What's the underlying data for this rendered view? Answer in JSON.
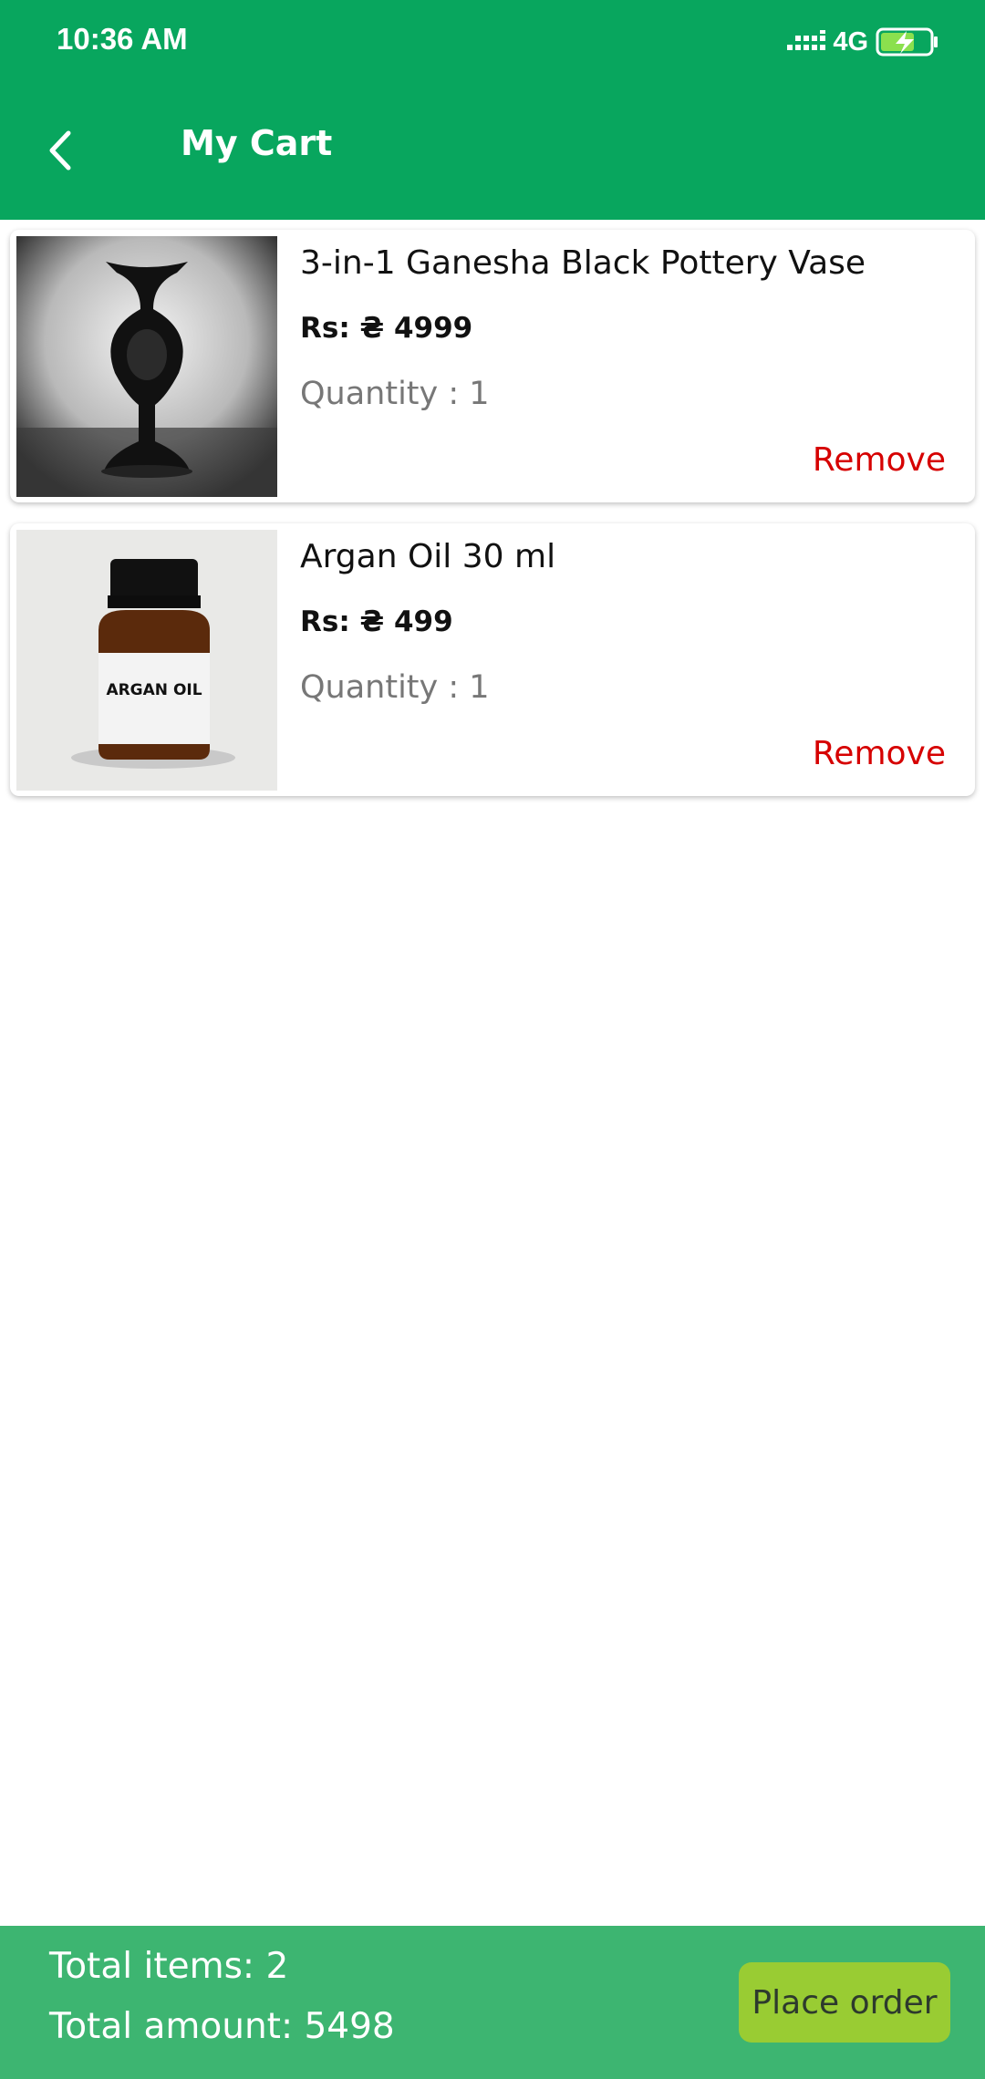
{
  "status_bar": {
    "time": "10:36 AM",
    "network": "4G"
  },
  "header": {
    "title": "My Cart",
    "back_icon": "back-arrow-icon",
    "color": "#08a65e"
  },
  "cart": {
    "items": [
      {
        "name": "3-in-1 Ganesha Black Pottery Vase",
        "price": "Rs: ₴  4999",
        "quantity": "Quantity : 1",
        "remove_label": "Remove"
      },
      {
        "name": "Argan Oil 30 ml",
        "price": "Rs: ₴  499",
        "quantity": "Quantity : 1",
        "remove_label": "Remove",
        "image_label": "ARGAN OIL"
      }
    ]
  },
  "footer": {
    "total_items": "Total items: 2",
    "total_amount": "Total amount: 5498",
    "place_order_label": "Place order",
    "bar_color": "#3db571",
    "button_color": "#99cc33"
  }
}
